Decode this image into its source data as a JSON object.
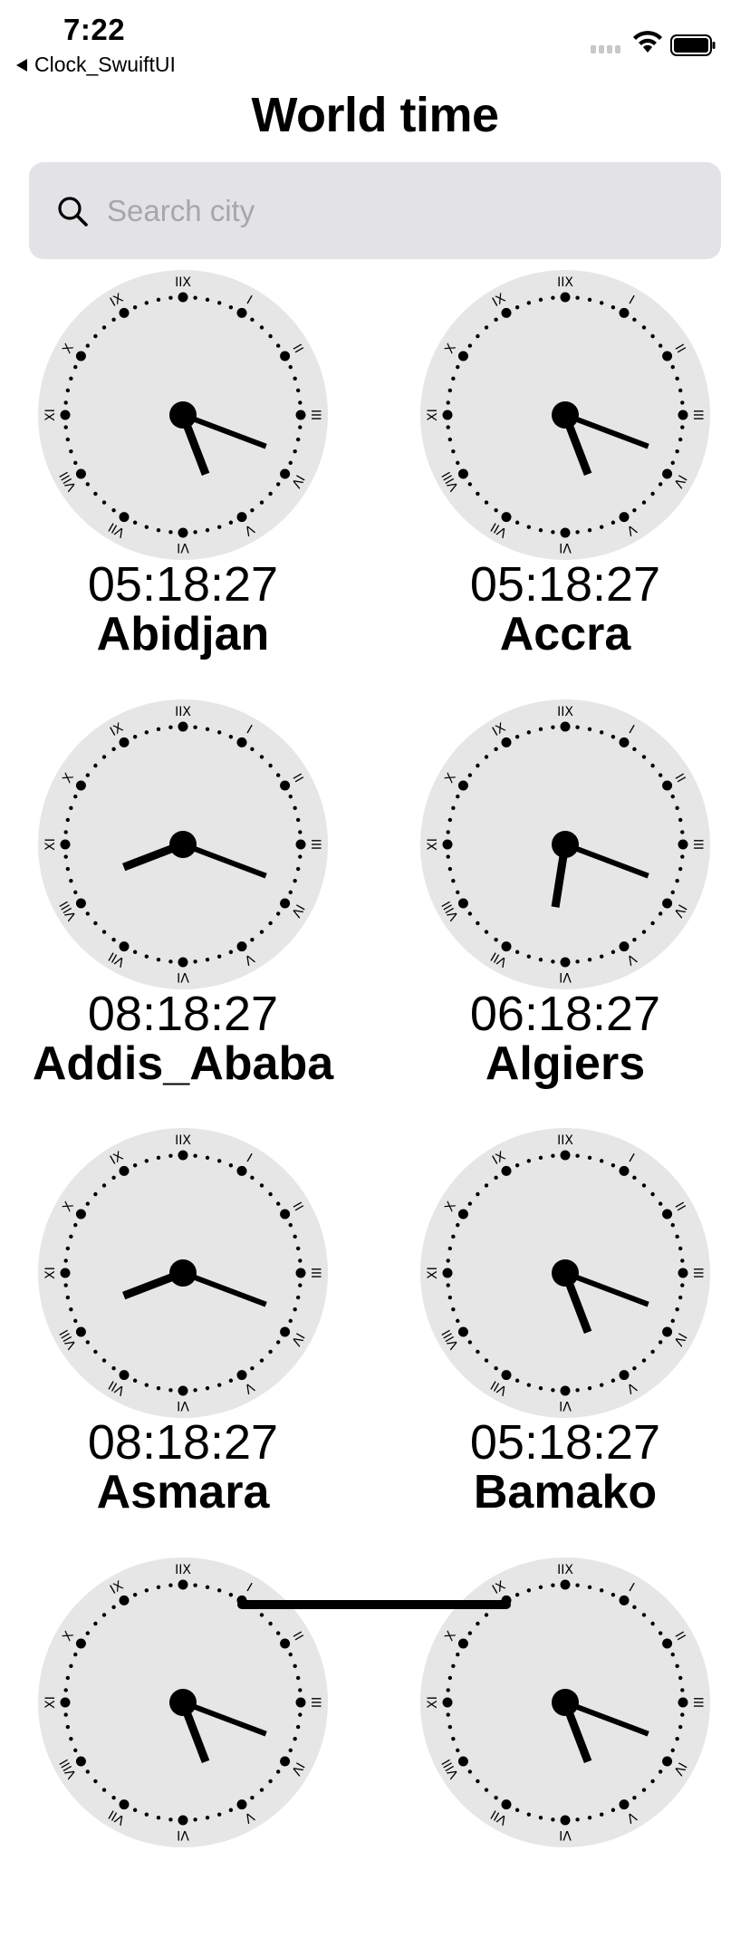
{
  "status_bar": {
    "time": "7:22",
    "back_label": "Clock_SwuiftUI"
  },
  "header": {
    "title": "World time"
  },
  "search": {
    "placeholder": "Search city",
    "value": ""
  },
  "clocks": [
    {
      "city": "Abidjan",
      "time": "05:18:27"
    },
    {
      "city": "Accra",
      "time": "05:18:27"
    },
    {
      "city": "Addis_Ababa",
      "time": "08:18:27"
    },
    {
      "city": "Algiers",
      "time": "06:18:27"
    },
    {
      "city": "Asmara",
      "time": "08:18:27"
    },
    {
      "city": "Bamako",
      "time": "05:18:27"
    }
  ],
  "clock_face": {
    "numerals": [
      "IIX",
      "I",
      "II",
      "III",
      "IV",
      "V",
      "VI",
      "VII",
      "VIII",
      "XI",
      "X",
      "IX"
    ],
    "face_color": "#e6e6e6"
  }
}
